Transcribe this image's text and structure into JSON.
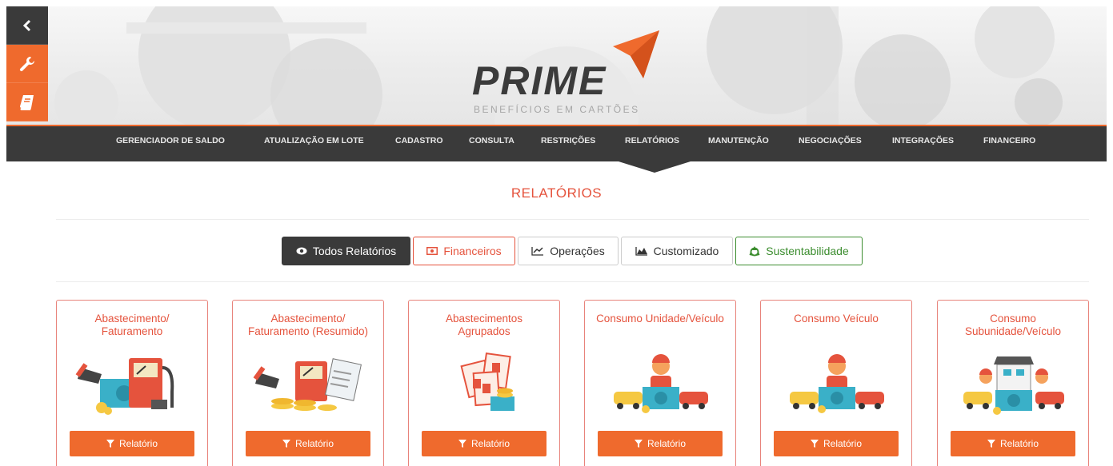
{
  "brand": {
    "logo_text": "PRIME",
    "tagline": "BENEFÍCIOS EM CARTÕES",
    "accent_color": "#ef6a2d",
    "dark_color": "#3a3a3a"
  },
  "side_toolbar": {
    "items": [
      {
        "icon": "chevron-left-icon"
      },
      {
        "icon": "wrench-icon"
      },
      {
        "icon": "book-icon"
      }
    ]
  },
  "nav": {
    "items": [
      {
        "label": "GERENCIADOR DE SALDO"
      },
      {
        "label": "ATUALIZAÇÃO EM LOTE"
      },
      {
        "label": "CADASTRO"
      },
      {
        "label": "CONSULTA"
      },
      {
        "label": "RESTRIÇÕES"
      },
      {
        "label": "RELATÓRIOS",
        "active": true
      },
      {
        "label": "MANUTENÇÃO"
      },
      {
        "label": "NEGOCIAÇÕES"
      },
      {
        "label": "INTEGRAÇÕES"
      },
      {
        "label": "FINANCEIRO"
      }
    ]
  },
  "page_title": "RELATÓRIOS",
  "filters": [
    {
      "label": "Todos Relatórios",
      "icon": "eye-icon",
      "active": true
    },
    {
      "label": "Financeiros",
      "icon": "money-icon"
    },
    {
      "label": "Operações",
      "icon": "line-chart-icon"
    },
    {
      "label": "Customizado",
      "icon": "area-chart-icon"
    },
    {
      "label": "Sustentabilidade",
      "icon": "recycle-icon"
    }
  ],
  "cards": [
    {
      "title_lines": [
        "Abastecimento/",
        "Faturamento"
      ],
      "illustration": "fuel-pump-money-illustration",
      "button_label": "Relatório"
    },
    {
      "title_lines": [
        "Abastecimento/",
        "Faturamento (Resumido)"
      ],
      "illustration": "fuel-pump-coins-illustration",
      "button_label": "Relatório"
    },
    {
      "title_lines": [
        "Abastecimentos",
        "Agrupados"
      ],
      "illustration": "grouped-documents-illustration",
      "button_label": "Relatório"
    },
    {
      "title_lines": [
        "Consumo Unidade/Veículo"
      ],
      "illustration": "driver-cars-illustration",
      "button_label": "Relatório"
    },
    {
      "title_lines": [
        "Consumo Veículo"
      ],
      "illustration": "driver-cars-illustration",
      "button_label": "Relatório"
    },
    {
      "title_lines": [
        "Consumo",
        "Subunidade/Veículo"
      ],
      "illustration": "store-cars-illustration",
      "button_label": "Relatório"
    }
  ]
}
